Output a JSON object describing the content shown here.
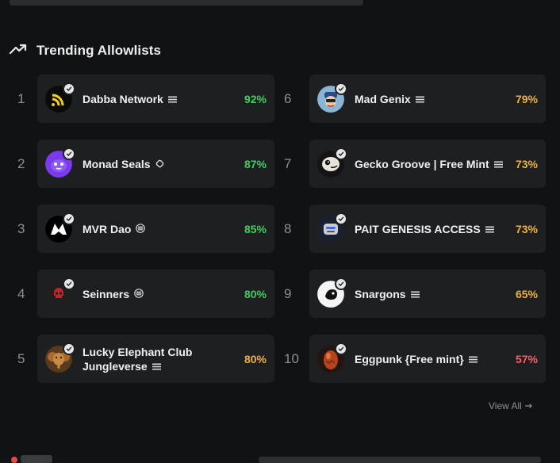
{
  "section": {
    "title": "Trending Allowlists"
  },
  "view_all": "View All",
  "colors": {
    "high": "#3ecf5f",
    "mid": "#f0b03a",
    "low": "#f26363"
  },
  "items": [
    {
      "rank": "1",
      "name": "Dabba Network",
      "chain": "eth",
      "pct": "92%",
      "level": "high",
      "avatar": "dabba-logo"
    },
    {
      "rank": "2",
      "name": "Monad Seals",
      "chain": "monad",
      "pct": "87%",
      "level": "high",
      "avatar": "monad-seal"
    },
    {
      "rank": "3",
      "name": "MVR Dao",
      "chain": "eth-circle",
      "pct": "85%",
      "level": "high",
      "avatar": "mvr-logo"
    },
    {
      "rank": "4",
      "name": "Seinners",
      "chain": "eth-circle",
      "pct": "80%",
      "level": "high",
      "avatar": "seinners-skull"
    },
    {
      "rank": "5",
      "name": "Lucky Elephant Club Jungleverse",
      "chain": "eth",
      "pct": "80%",
      "level": "mid",
      "avatar": "elephant"
    },
    {
      "rank": "6",
      "name": "Mad Genix",
      "chain": "eth",
      "pct": "79%",
      "level": "mid",
      "avatar": "mad-genix"
    },
    {
      "rank": "7",
      "name": "Gecko Groove | Free Mint",
      "chain": "eth",
      "pct": "73%",
      "level": "mid",
      "avatar": "gecko"
    },
    {
      "rank": "8",
      "name": "PAIT GENESIS ACCESS",
      "chain": "eth",
      "pct": "73%",
      "level": "mid",
      "avatar": "pait-robot"
    },
    {
      "rank": "9",
      "name": "Snargons",
      "chain": "eth",
      "pct": "65%",
      "level": "mid",
      "avatar": "snargons"
    },
    {
      "rank": "10",
      "name": "Eggpunk {Free mint}",
      "chain": "eth",
      "pct": "57%",
      "level": "low",
      "avatar": "egg"
    }
  ]
}
